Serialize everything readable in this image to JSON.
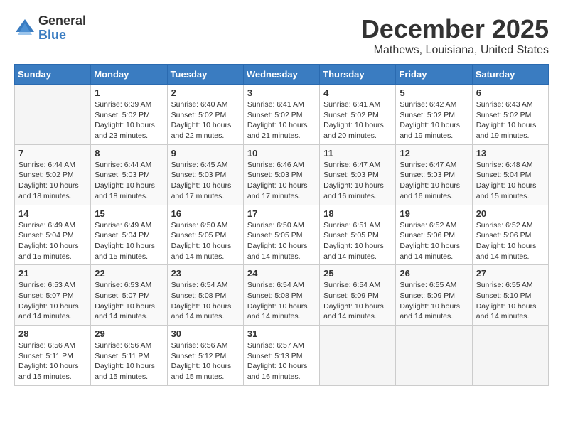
{
  "logo": {
    "general": "General",
    "blue": "Blue"
  },
  "title": "December 2025",
  "location": "Mathews, Louisiana, United States",
  "days_of_week": [
    "Sunday",
    "Monday",
    "Tuesday",
    "Wednesday",
    "Thursday",
    "Friday",
    "Saturday"
  ],
  "weeks": [
    [
      {
        "day": "",
        "sunrise": "",
        "sunset": "",
        "daylight": "",
        "empty": true
      },
      {
        "day": "1",
        "sunrise": "Sunrise: 6:39 AM",
        "sunset": "Sunset: 5:02 PM",
        "daylight": "Daylight: 10 hours and 23 minutes."
      },
      {
        "day": "2",
        "sunrise": "Sunrise: 6:40 AM",
        "sunset": "Sunset: 5:02 PM",
        "daylight": "Daylight: 10 hours and 22 minutes."
      },
      {
        "day": "3",
        "sunrise": "Sunrise: 6:41 AM",
        "sunset": "Sunset: 5:02 PM",
        "daylight": "Daylight: 10 hours and 21 minutes."
      },
      {
        "day": "4",
        "sunrise": "Sunrise: 6:41 AM",
        "sunset": "Sunset: 5:02 PM",
        "daylight": "Daylight: 10 hours and 20 minutes."
      },
      {
        "day": "5",
        "sunrise": "Sunrise: 6:42 AM",
        "sunset": "Sunset: 5:02 PM",
        "daylight": "Daylight: 10 hours and 19 minutes."
      },
      {
        "day": "6",
        "sunrise": "Sunrise: 6:43 AM",
        "sunset": "Sunset: 5:02 PM",
        "daylight": "Daylight: 10 hours and 19 minutes."
      }
    ],
    [
      {
        "day": "7",
        "sunrise": "Sunrise: 6:44 AM",
        "sunset": "Sunset: 5:02 PM",
        "daylight": "Daylight: 10 hours and 18 minutes."
      },
      {
        "day": "8",
        "sunrise": "Sunrise: 6:44 AM",
        "sunset": "Sunset: 5:03 PM",
        "daylight": "Daylight: 10 hours and 18 minutes."
      },
      {
        "day": "9",
        "sunrise": "Sunrise: 6:45 AM",
        "sunset": "Sunset: 5:03 PM",
        "daylight": "Daylight: 10 hours and 17 minutes."
      },
      {
        "day": "10",
        "sunrise": "Sunrise: 6:46 AM",
        "sunset": "Sunset: 5:03 PM",
        "daylight": "Daylight: 10 hours and 17 minutes."
      },
      {
        "day": "11",
        "sunrise": "Sunrise: 6:47 AM",
        "sunset": "Sunset: 5:03 PM",
        "daylight": "Daylight: 10 hours and 16 minutes."
      },
      {
        "day": "12",
        "sunrise": "Sunrise: 6:47 AM",
        "sunset": "Sunset: 5:03 PM",
        "daylight": "Daylight: 10 hours and 16 minutes."
      },
      {
        "day": "13",
        "sunrise": "Sunrise: 6:48 AM",
        "sunset": "Sunset: 5:04 PM",
        "daylight": "Daylight: 10 hours and 15 minutes."
      }
    ],
    [
      {
        "day": "14",
        "sunrise": "Sunrise: 6:49 AM",
        "sunset": "Sunset: 5:04 PM",
        "daylight": "Daylight: 10 hours and 15 minutes."
      },
      {
        "day": "15",
        "sunrise": "Sunrise: 6:49 AM",
        "sunset": "Sunset: 5:04 PM",
        "daylight": "Daylight: 10 hours and 15 minutes."
      },
      {
        "day": "16",
        "sunrise": "Sunrise: 6:50 AM",
        "sunset": "Sunset: 5:05 PM",
        "daylight": "Daylight: 10 hours and 14 minutes."
      },
      {
        "day": "17",
        "sunrise": "Sunrise: 6:50 AM",
        "sunset": "Sunset: 5:05 PM",
        "daylight": "Daylight: 10 hours and 14 minutes."
      },
      {
        "day": "18",
        "sunrise": "Sunrise: 6:51 AM",
        "sunset": "Sunset: 5:05 PM",
        "daylight": "Daylight: 10 hours and 14 minutes."
      },
      {
        "day": "19",
        "sunrise": "Sunrise: 6:52 AM",
        "sunset": "Sunset: 5:06 PM",
        "daylight": "Daylight: 10 hours and 14 minutes."
      },
      {
        "day": "20",
        "sunrise": "Sunrise: 6:52 AM",
        "sunset": "Sunset: 5:06 PM",
        "daylight": "Daylight: 10 hours and 14 minutes."
      }
    ],
    [
      {
        "day": "21",
        "sunrise": "Sunrise: 6:53 AM",
        "sunset": "Sunset: 5:07 PM",
        "daylight": "Daylight: 10 hours and 14 minutes."
      },
      {
        "day": "22",
        "sunrise": "Sunrise: 6:53 AM",
        "sunset": "Sunset: 5:07 PM",
        "daylight": "Daylight: 10 hours and 14 minutes."
      },
      {
        "day": "23",
        "sunrise": "Sunrise: 6:54 AM",
        "sunset": "Sunset: 5:08 PM",
        "daylight": "Daylight: 10 hours and 14 minutes."
      },
      {
        "day": "24",
        "sunrise": "Sunrise: 6:54 AM",
        "sunset": "Sunset: 5:08 PM",
        "daylight": "Daylight: 10 hours and 14 minutes."
      },
      {
        "day": "25",
        "sunrise": "Sunrise: 6:54 AM",
        "sunset": "Sunset: 5:09 PM",
        "daylight": "Daylight: 10 hours and 14 minutes."
      },
      {
        "day": "26",
        "sunrise": "Sunrise: 6:55 AM",
        "sunset": "Sunset: 5:09 PM",
        "daylight": "Daylight: 10 hours and 14 minutes."
      },
      {
        "day": "27",
        "sunrise": "Sunrise: 6:55 AM",
        "sunset": "Sunset: 5:10 PM",
        "daylight": "Daylight: 10 hours and 14 minutes."
      }
    ],
    [
      {
        "day": "28",
        "sunrise": "Sunrise: 6:56 AM",
        "sunset": "Sunset: 5:11 PM",
        "daylight": "Daylight: 10 hours and 15 minutes."
      },
      {
        "day": "29",
        "sunrise": "Sunrise: 6:56 AM",
        "sunset": "Sunset: 5:11 PM",
        "daylight": "Daylight: 10 hours and 15 minutes."
      },
      {
        "day": "30",
        "sunrise": "Sunrise: 6:56 AM",
        "sunset": "Sunset: 5:12 PM",
        "daylight": "Daylight: 10 hours and 15 minutes."
      },
      {
        "day": "31",
        "sunrise": "Sunrise: 6:57 AM",
        "sunset": "Sunset: 5:13 PM",
        "daylight": "Daylight: 10 hours and 16 minutes."
      },
      {
        "day": "",
        "sunrise": "",
        "sunset": "",
        "daylight": "",
        "empty": true
      },
      {
        "day": "",
        "sunrise": "",
        "sunset": "",
        "daylight": "",
        "empty": true
      },
      {
        "day": "",
        "sunrise": "",
        "sunset": "",
        "daylight": "",
        "empty": true
      }
    ]
  ]
}
